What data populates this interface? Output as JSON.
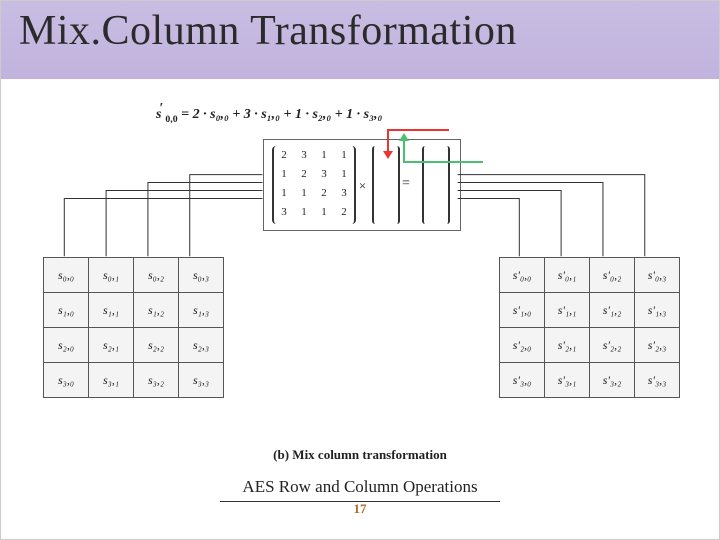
{
  "title": "Mix.Column Transformation",
  "equation": {
    "lhs": "s'₀,₀",
    "rhs": "= 2 · s₀,₀ + 3 · s₁,₀ + 1 · s₂,₀ + 1 · s₃,₀"
  },
  "mix_matrix": [
    [
      "2",
      "3",
      "1",
      "1"
    ],
    [
      "1",
      "2",
      "3",
      "1"
    ],
    [
      "1",
      "1",
      "2",
      "3"
    ],
    [
      "3",
      "1",
      "1",
      "2"
    ]
  ],
  "times_symbol": "×",
  "equals_symbol": "=",
  "state_in": [
    [
      "s₀,₀",
      "s₀,₁",
      "s₀,₂",
      "s₀,₃"
    ],
    [
      "s₁,₀",
      "s₁,₁",
      "s₁,₂",
      "s₁,₃"
    ],
    [
      "s₂,₀",
      "s₂,₁",
      "s₂,₂",
      "s₂,₃"
    ],
    [
      "s₃,₀",
      "s₃,₁",
      "s₃,₂",
      "s₃,₃"
    ]
  ],
  "state_out": [
    [
      "s'₀,₀",
      "s'₀,₁",
      "s'₀,₂",
      "s'₀,₃"
    ],
    [
      "s'₁,₀",
      "s'₁,₁",
      "s'₁,₂",
      "s'₁,₃"
    ],
    [
      "s'₂,₀",
      "s'₂,₁",
      "s'₂,₂",
      "s'₂,₃"
    ],
    [
      "s'₃,₀",
      "s'₃,₁",
      "s'₃,₂",
      "s'₃,₃"
    ]
  ],
  "caption_b": "(b) Mix column transformation",
  "caption_main": "AES Row and Column Operations",
  "page_number": "17"
}
